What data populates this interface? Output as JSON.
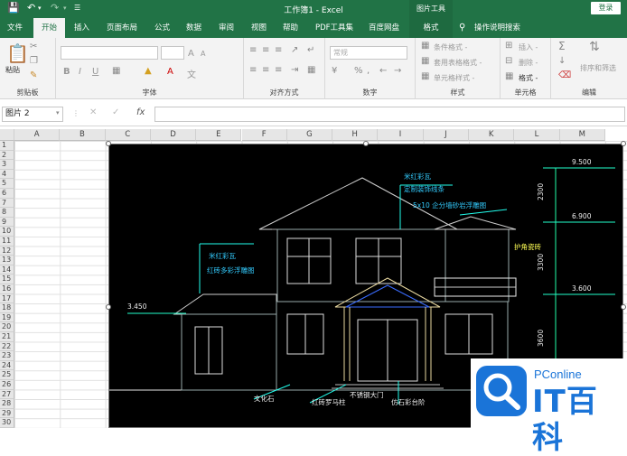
{
  "title_bar": {
    "document_title": "工作簿1 - Excel",
    "context_title": "图片工具",
    "login_label": "登录",
    "icons": [
      "save-icon",
      "undo-icon",
      "redo-icon",
      "customize-icon"
    ]
  },
  "tabs": [
    {
      "label": "文件"
    },
    {
      "label": "开始",
      "active": true
    },
    {
      "label": "插入"
    },
    {
      "label": "页面布局"
    },
    {
      "label": "公式"
    },
    {
      "label": "数据"
    },
    {
      "label": "审阅"
    },
    {
      "label": "视图"
    },
    {
      "label": "帮助"
    },
    {
      "label": "PDF工具集"
    },
    {
      "label": "百度网盘"
    },
    {
      "label": "格式",
      "context": true
    }
  ],
  "tell_me": "操作说明搜索",
  "ribbon": {
    "clipboard": {
      "label": "剪贴板",
      "paste": "粘贴"
    },
    "font": {
      "label": "字体",
      "bold": "B",
      "italic": "I",
      "underline": "U",
      "increase": "A",
      "decrease": "A",
      "font_color": "A",
      "wen": "文"
    },
    "alignment": {
      "label": "对齐方式"
    },
    "number": {
      "label": "数字",
      "format": "常规"
    },
    "styles": {
      "label": "样式",
      "items": [
        "条件格式 -",
        "套用表格格式 -",
        "单元格样式 -"
      ]
    },
    "cells": {
      "label": "单元格",
      "items": [
        "插入 -",
        "删除 -",
        "格式 -"
      ]
    },
    "editing": {
      "label": "编辑",
      "sort": "排序和筛选"
    }
  },
  "formula_bar": {
    "name_box": "图片 2",
    "fx": "fx",
    "value": ""
  },
  "columns": [
    "A",
    "B",
    "C",
    "D",
    "E",
    "F",
    "G",
    "H",
    "I",
    "J",
    "K",
    "L",
    "M"
  ],
  "rows": [
    "1",
    "2",
    "3",
    "4",
    "5",
    "6",
    "7",
    "8",
    "9",
    "10",
    "11",
    "12",
    "13",
    "14",
    "15",
    "16",
    "17",
    "18",
    "19",
    "20",
    "21",
    "22",
    "23",
    "24",
    "25",
    "26",
    "27",
    "28",
    "29",
    "30"
  ],
  "drawing": {
    "notes": [
      "米红彩瓦",
      "定制装饰线条",
      "5x10 企分墙砂岩浮雕图",
      "护角瓷砖",
      "米红彩瓦",
      "红砖多彩浮雕图",
      "文化石",
      "红砖罗马柱",
      "不锈钢大门",
      "仿石彩台阶"
    ],
    "elevations": [
      "9.500",
      "6.900",
      "3.600",
      "3.450"
    ],
    "dims": [
      "2300",
      "3300",
      "3600"
    ]
  },
  "watermark": {
    "brand": "PConline",
    "name": "IT百科"
  },
  "colors": {
    "excel_green": "#217346",
    "cad_bg": "#000000",
    "logo_blue": "#1a74d8"
  }
}
